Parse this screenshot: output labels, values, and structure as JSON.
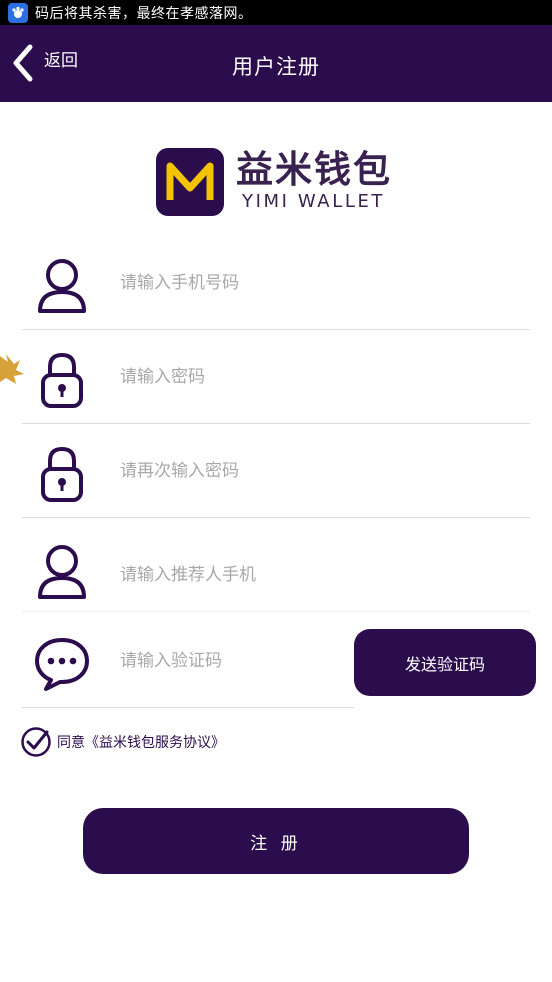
{
  "status_bar": {
    "notice": "码后将其杀害，最终在孝感落网。"
  },
  "header": {
    "back_label": "返回",
    "title": "用户注册"
  },
  "logo": {
    "name_cn": "益米钱包",
    "name_en": "YIMI WALLET"
  },
  "form": {
    "phone": {
      "placeholder": "请输入手机号码",
      "value": ""
    },
    "password": {
      "placeholder": "请输入密码",
      "value": ""
    },
    "password_confirm": {
      "placeholder": "请再次输入密码",
      "value": ""
    },
    "referrer_phone": {
      "placeholder": "请输入推荐人手机",
      "value": ""
    },
    "verify_code": {
      "placeholder": "请输入验证码",
      "value": ""
    },
    "send_code_label": "发送验证码",
    "agreement_label": "同意《益米钱包服务协议》",
    "agreement_checked": true,
    "submit_label": "注 册"
  },
  "colors": {
    "primary": "#2b0d4d",
    "logo_accent": "#f5c400",
    "divider": "#dcdcdc",
    "placeholder": "#a8a8a8"
  },
  "icons": [
    "app-notification-icon",
    "back-chevron-icon",
    "user-icon",
    "lock-icon",
    "lock-icon",
    "user-icon",
    "chat-bubble-icon",
    "check-circle-icon",
    "maple-leaf-icon"
  ]
}
